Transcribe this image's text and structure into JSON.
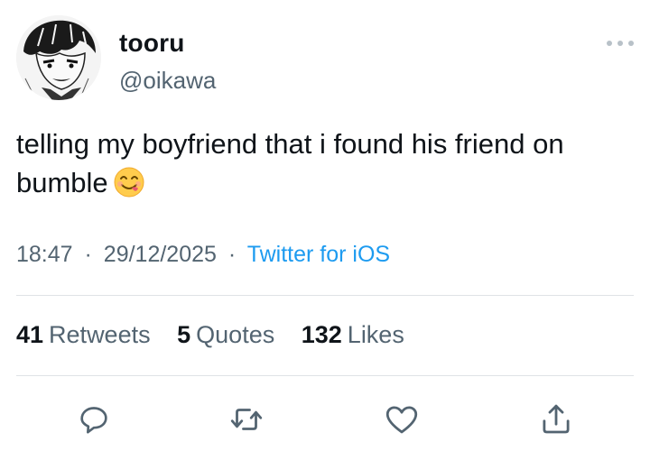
{
  "author": {
    "name": "tooru",
    "handle": "@oikawa"
  },
  "tweet": {
    "text": "telling my boyfriend that i found his friend on bumble",
    "emoji": "face-savoring-food",
    "time": "18:47",
    "date": "29/12/2025",
    "separator": "·",
    "source": "Twitter for iOS"
  },
  "stats": {
    "retweets_count": "41",
    "retweets_label": "Retweets",
    "quotes_count": "5",
    "quotes_label": "Quotes",
    "likes_count": "132",
    "likes_label": "Likes"
  },
  "icons": {
    "more": "more-horizontal-icon",
    "reply": "reply-icon",
    "retweet": "retweet-icon",
    "like": "heart-icon",
    "share": "share-icon"
  },
  "colors": {
    "text_primary": "#0f1419",
    "text_secondary": "#536471",
    "link": "#1d9bf0",
    "divider": "#dfe3e6"
  }
}
